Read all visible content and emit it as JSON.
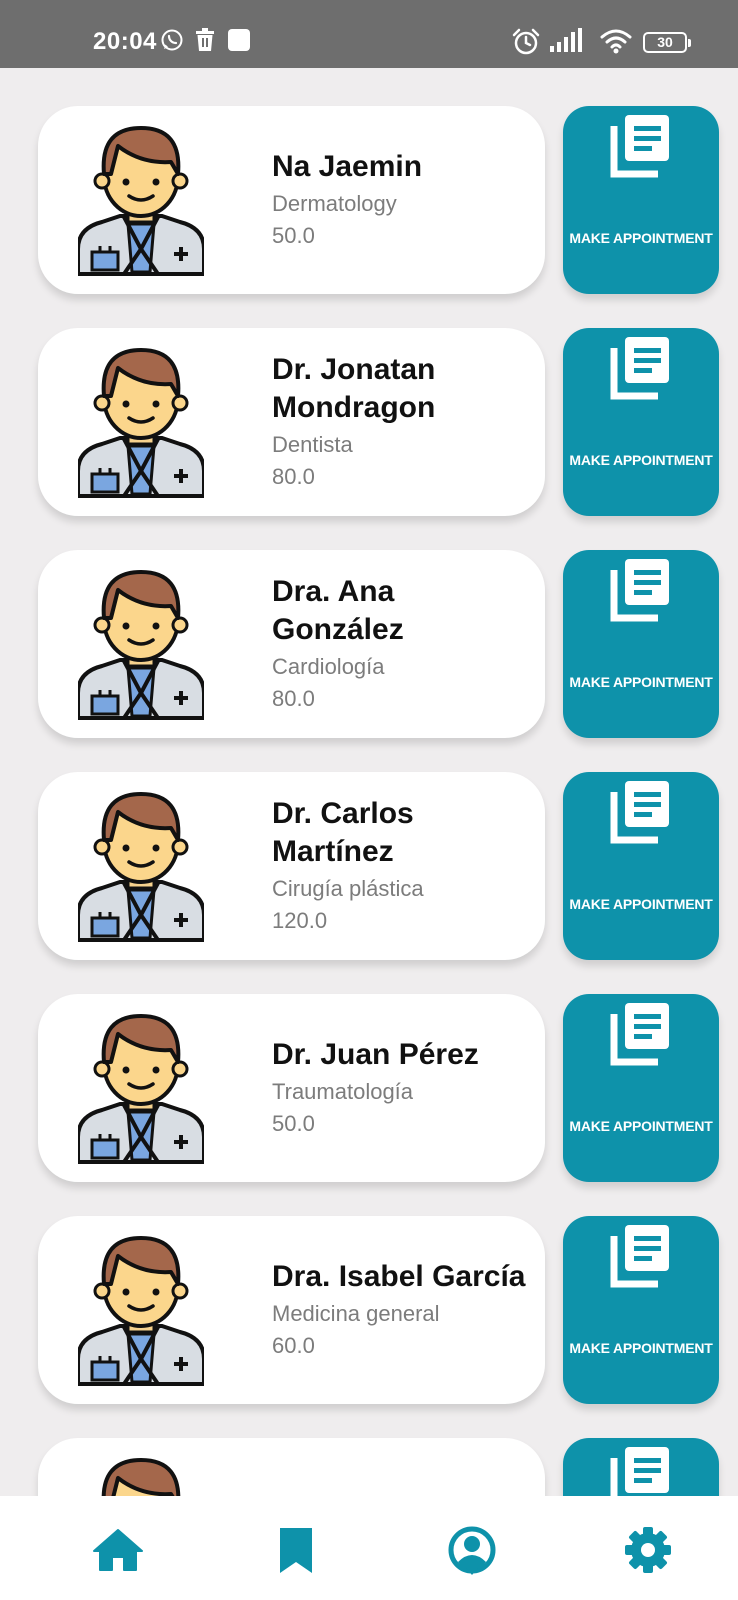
{
  "status_bar": {
    "time": "20:04",
    "battery": "30",
    "icons": [
      "whatsapp-icon",
      "trash-icon",
      "app-icon",
      "alarm-icon",
      "signal-icon",
      "wifi-icon",
      "battery-icon"
    ]
  },
  "accent_color": "#0e92aa",
  "doctors": [
    {
      "name": "Na Jaemin",
      "specialty": "Dermatology",
      "price": "50.0",
      "button_label": "MAKE APPOINTMENT"
    },
    {
      "name": "Dr. Jonatan Mondragon",
      "specialty": "Dentista",
      "price": "80.0",
      "button_label": "MAKE APPOINTMENT"
    },
    {
      "name": "Dra. Ana González",
      "specialty": "Cardiología",
      "price": "80.0",
      "button_label": "MAKE APPOINTMENT"
    },
    {
      "name": "Dr. Carlos Martínez",
      "specialty": "Cirugía plástica",
      "price": "120.0",
      "button_label": "MAKE APPOINTMENT"
    },
    {
      "name": "Dr. Juan Pérez",
      "specialty": "Traumatología",
      "price": "50.0",
      "button_label": "MAKE APPOINTMENT"
    },
    {
      "name": "Dra. Isabel García",
      "specialty": "Medicina general",
      "price": "60.0",
      "button_label": "MAKE APPOINTMENT"
    },
    {
      "name": "",
      "specialty": "",
      "price": "",
      "button_label": ""
    }
  ],
  "bottom_nav": [
    {
      "icon": "home-icon"
    },
    {
      "icon": "bookmark-icon"
    },
    {
      "icon": "profile-icon"
    },
    {
      "icon": "settings-icon"
    }
  ]
}
